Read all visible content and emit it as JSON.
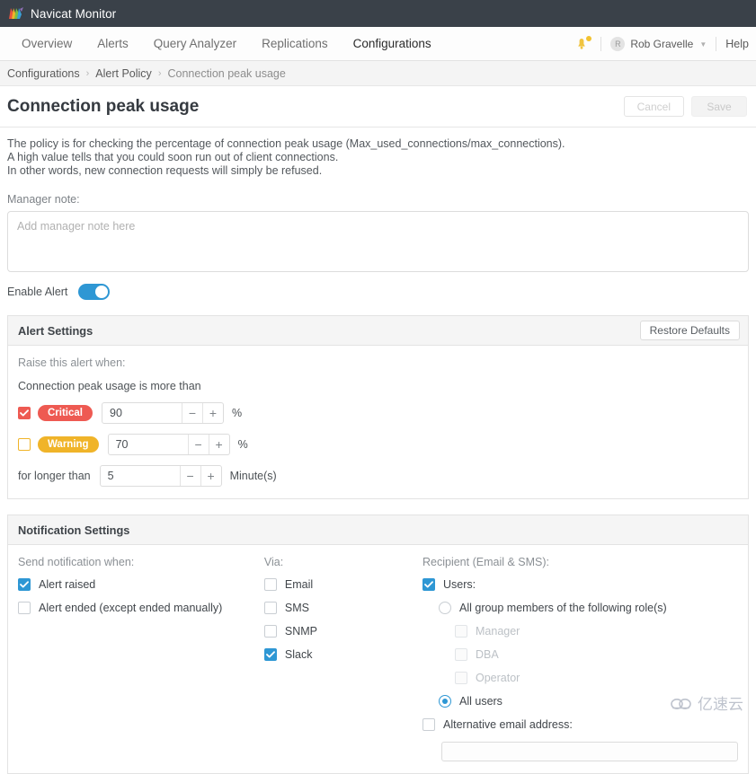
{
  "app": {
    "title": "Navicat Monitor",
    "logo_icon": "navicat-logo-icon"
  },
  "nav": {
    "items": [
      {
        "label": "Overview",
        "active": false
      },
      {
        "label": "Alerts",
        "active": false
      },
      {
        "label": "Query Analyzer",
        "active": false
      },
      {
        "label": "Replications",
        "active": false
      },
      {
        "label": "Configurations",
        "active": true
      }
    ],
    "bell_icon": "notification-bell-icon",
    "user": {
      "avatar_initial": "R",
      "name": "Rob Gravelle",
      "caret_icon": "chevron-down-icon"
    },
    "help_label": "Help"
  },
  "breadcrumb": {
    "items": [
      "Configurations",
      "Alert Policy",
      "Connection peak usage"
    ],
    "separator": "›"
  },
  "page": {
    "title": "Connection peak usage",
    "cancel_label": "Cancel",
    "save_label": "Save",
    "description": [
      "The policy is for checking the percentage of connection peak usage (Max_used_connections/max_connections).",
      "A high value tells that you could soon run out of client connections.",
      "In other words, new connection requests will simply be refused."
    ]
  },
  "manager_note": {
    "label": "Manager note:",
    "placeholder": "Add manager note here",
    "value": ""
  },
  "enable_alert": {
    "label": "Enable Alert",
    "enabled": true
  },
  "alert_settings": {
    "title": "Alert Settings",
    "restore_label": "Restore Defaults",
    "raise_when_label": "Raise this alert when:",
    "condition_label": "Connection peak usage is more than",
    "thresholds": [
      {
        "name": "critical",
        "badge": "Critical",
        "checked": true,
        "value": "90",
        "unit": "%",
        "minus": "−",
        "plus": "+"
      },
      {
        "name": "warning",
        "badge": "Warning",
        "checked": false,
        "value": "70",
        "unit": "%",
        "minus": "−",
        "plus": "+"
      }
    ],
    "duration": {
      "label": "for longer than",
      "value": "5",
      "unit": "Minute(s)",
      "minus": "−",
      "plus": "+"
    }
  },
  "notification_settings": {
    "title": "Notification Settings",
    "when": {
      "heading": "Send notification when:",
      "options": [
        {
          "label": "Alert raised",
          "checked": true
        },
        {
          "label": "Alert ended (except ended manually)",
          "checked": false
        }
      ]
    },
    "via": {
      "heading": "Via:",
      "options": [
        {
          "label": "Email",
          "checked": false
        },
        {
          "label": "SMS",
          "checked": false
        },
        {
          "label": "SNMP",
          "checked": false
        },
        {
          "label": "Slack",
          "checked": true
        }
      ]
    },
    "recipient": {
      "heading": "Recipient (Email & SMS):",
      "users": {
        "label": "Users:",
        "checked": true
      },
      "radios": [
        {
          "label": "All group members of the following role(s)",
          "selected": false
        },
        {
          "label": "All users",
          "selected": true
        }
      ],
      "roles": [
        {
          "label": "Manager",
          "checked": false,
          "disabled": true
        },
        {
          "label": "DBA",
          "checked": false,
          "disabled": true
        },
        {
          "label": "Operator",
          "checked": false,
          "disabled": true
        }
      ],
      "alternative_email": {
        "label": "Alternative email address:",
        "checked": false,
        "value": ""
      }
    }
  },
  "watermark": {
    "icon": "cloud-icon",
    "text": "亿速云"
  },
  "colors": {
    "titlebar": "#3a4149",
    "accent_blue": "#2e97d4",
    "critical_red": "#ee5a52",
    "warning_orange": "#f0b429"
  }
}
